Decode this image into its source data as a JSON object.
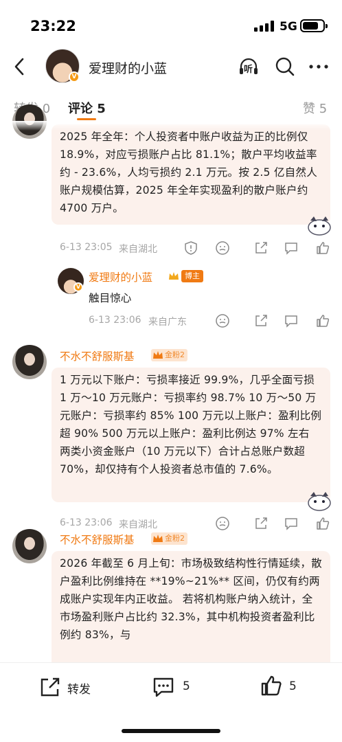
{
  "status": {
    "time": "23:22",
    "network": "5G"
  },
  "header": {
    "title": "爱理财的小蓝",
    "avatar_icon": "user-avatar-icon",
    "listen_label": "听"
  },
  "tabs": {
    "forward": "转发 0",
    "comments": "评论 5",
    "likes": "赞 5"
  },
  "comments": [
    {
      "text": "2025 年全年：个人投资者中账户收益为正的比例仅 18.9%，对应亏损账户占比 81.1%；散户平均收益率约 - 23.6%，人均亏损约 2.1 万元。按 2.5 亿自然人账户规模估算，2025 年全年实现盈利的散户账户约 4700 万户。",
      "time": "6-13 23:05",
      "location": "来自湖北",
      "reply": {
        "user": "爱理财的小蓝",
        "badge": "博主",
        "text": "触目惊心",
        "time": "6-13 23:06",
        "location": "来自广东"
      }
    },
    {
      "user": "不水不舒服斯基",
      "level": "金粉2",
      "text": "1 万元以下账户：亏损率接近 99.9%，几乎全面亏损 1 万～10 万元账户：亏损率约 98.7% 10 万～50 万元账户：亏损率约 85% 100 万元以上账户：盈利比例超 90% 500 万元以上账户：盈利比例达 97% 左右 两类小资金账户（10 万元以下）合计占总账户数超 70%，却仅持有个人投资者总市值的 7.6%。",
      "time": "6-13 23:06",
      "location": "来自湖北"
    },
    {
      "user": "不水不舒服斯基",
      "level": "金粉2",
      "text": "2026 年截至 6 月上旬：市场极致结构性行情延续，散户盈利比例维持在 **19%~21%** 区间，仍仅有约两成账户实现年内正收益。 若将机构账户纳入统计，全市场盈利账户占比约 32.3%，其中机构投资者盈利比例约 83%，与"
    }
  ],
  "bottom": {
    "forward_label": "转发",
    "comment_count": "5",
    "like_count": "5"
  }
}
